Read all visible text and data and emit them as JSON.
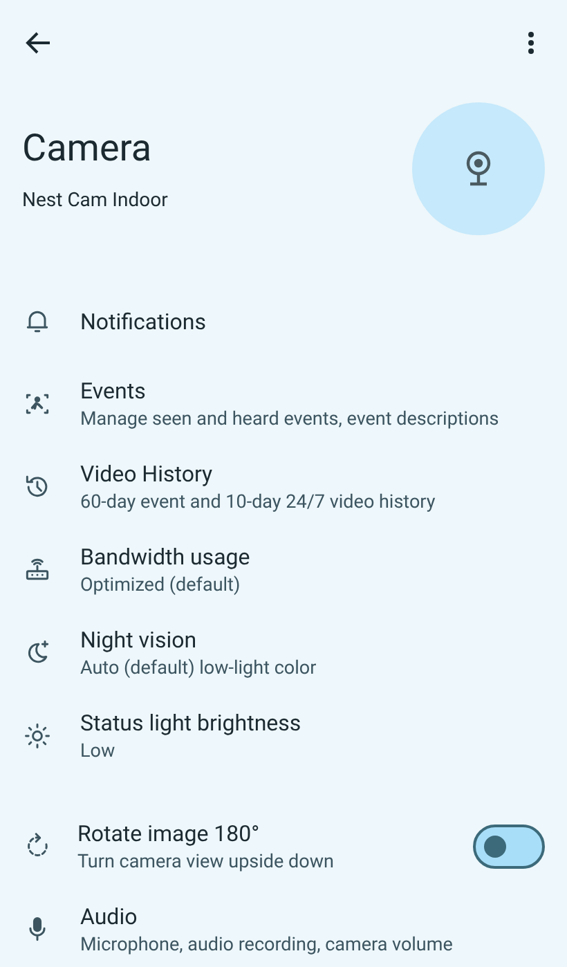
{
  "title": "Camera",
  "subtitle": "Nest Cam Indoor",
  "items": [
    {
      "kind": "link",
      "label": "Notifications"
    },
    {
      "kind": "link",
      "label": "Events",
      "summary": "Manage seen and heard events, event descriptions"
    },
    {
      "kind": "link",
      "label": "Video History",
      "summary": "60-day event and 10-day 24/7 video history"
    },
    {
      "kind": "link",
      "label": "Bandwidth usage",
      "summary": "Optimized (default)"
    },
    {
      "kind": "link",
      "label": "Night vision",
      "summary": "Auto (default) low-light color"
    },
    {
      "kind": "link",
      "label": "Status light brightness",
      "summary": "Low"
    },
    {
      "kind": "toggle",
      "label": "Rotate image 180°",
      "summary": "Turn camera view upside down",
      "on": false
    },
    {
      "kind": "link",
      "label": "Audio",
      "summary": "Microphone, audio recording, camera volume"
    }
  ]
}
